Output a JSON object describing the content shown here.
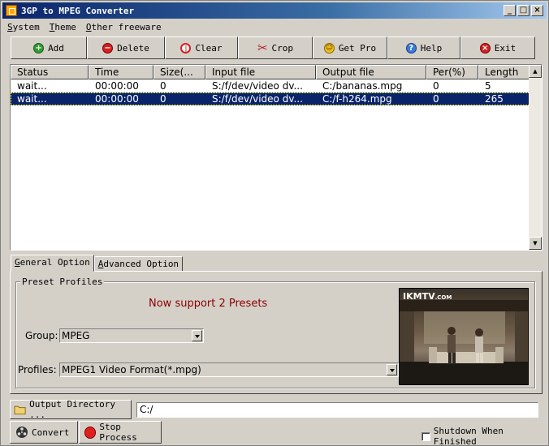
{
  "window": {
    "title": "3GP to MPEG Converter"
  },
  "titlebar_buttons": {
    "minimize": "_",
    "maximize": "□",
    "close": "×"
  },
  "menu": [
    {
      "label": "System",
      "underline": "S",
      "rest": "ystem"
    },
    {
      "label": "Theme",
      "underline": "T",
      "rest": "heme"
    },
    {
      "label": "Other freeware",
      "underline": "O",
      "rest": "ther freeware"
    }
  ],
  "toolbar": {
    "add": "Add",
    "delete": "Delete",
    "clear": "Clear",
    "crop": "Crop",
    "get_pro": "Get Pro",
    "help": "Help",
    "exit": "Exit"
  },
  "icons": {
    "add": "plus-circle-green",
    "delete": "minus-circle-red",
    "clear": "power-circle-red",
    "crop": "scissors",
    "get_pro": "smiley-yellow",
    "help": "question-circle-blue",
    "exit": "x-circle-red"
  },
  "table": {
    "columns": [
      "Status",
      "Time",
      "Size(...",
      "Input file",
      "Output file",
      "Per(%)",
      "Length"
    ],
    "rows": [
      {
        "status": "wait...",
        "time": "00:00:00",
        "size": "0",
        "input": "S:/f/dev/video dv...",
        "output": "C:/bananas.mpg",
        "percent": "0",
        "length": "5",
        "selected": false
      },
      {
        "status": "wait...",
        "time": "00:00:00",
        "size": "0",
        "input": "S:/f/dev/video dv...",
        "output": "C:/f-h264.mpg",
        "percent": "0",
        "length": "265",
        "selected": true
      }
    ]
  },
  "tabs": {
    "general": {
      "u": "G",
      "rest": "eneral Option"
    },
    "advanced": {
      "u": "A",
      "rest": "dvanced Option"
    }
  },
  "preset": {
    "group_label": "Preset Profiles",
    "support_text": "Now support 2 Presets",
    "group_field_label": "Group:",
    "group_value": "MPEG",
    "profiles_field_label": "Profiles:",
    "profiles_value": "MPEG1 Video Format(*.mpg)"
  },
  "ad": {
    "brand": "IKMTV",
    "suffix": ".COM"
  },
  "bottom": {
    "output_dir_button": "Output Directory ...",
    "output_dir_value": "C:/",
    "convert": "Convert",
    "stop": "Stop Process",
    "shutdown": "Shutdown When Finished"
  },
  "colors": {
    "titlebar_start": "#0a246a",
    "selection": "#0a246a",
    "support_text": "#8b0000",
    "face": "#d4d0c8"
  }
}
